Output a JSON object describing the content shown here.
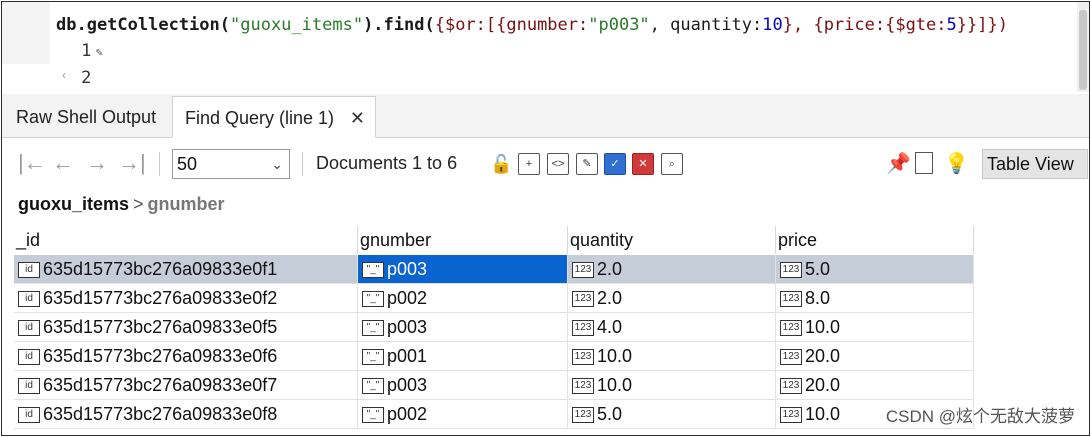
{
  "editor": {
    "line_numbers": [
      "1",
      "2"
    ],
    "code": {
      "obj": "db.getCollection(",
      "coll": "\"guoxu_items\"",
      "close_find": ").find(",
      "rest_pre": "{$or:[{gnumber:",
      "gval": "\"p003\"",
      "rest_mid": ", quantity:",
      "qval": "10",
      "rest_mid2": "}, {price:{$gte:",
      "pval": "5",
      "rest_end": "}}]})"
    }
  },
  "tabs": [
    {
      "label": "Raw Shell Output"
    },
    {
      "label": "Find Query (line 1)",
      "close": "✕"
    }
  ],
  "toolbar": {
    "nav": [
      "|←",
      "←",
      "→",
      "→|"
    ],
    "limit": "50",
    "doc_range": "Documents 1 to 6",
    "view_mode": "Table View"
  },
  "breadcrumb": {
    "collection": "guoxu_items",
    "separator": ">",
    "field": "gnumber"
  },
  "table": {
    "columns": [
      "_id",
      "gnumber",
      "quantity",
      "price"
    ],
    "rows": [
      {
        "id": "635d15773bc276a09833e0f1",
        "gnumber": "p003",
        "quantity": "2.0",
        "price": "5.0"
      },
      {
        "id": "635d15773bc276a09833e0f2",
        "gnumber": "p002",
        "quantity": "2.0",
        "price": "8.0"
      },
      {
        "id": "635d15773bc276a09833e0f5",
        "gnumber": "p003",
        "quantity": "4.0",
        "price": "10.0"
      },
      {
        "id": "635d15773bc276a09833e0f6",
        "gnumber": "p001",
        "quantity": "10.0",
        "price": "20.0"
      },
      {
        "id": "635d15773bc276a09833e0f7",
        "gnumber": "p003",
        "quantity": "10.0",
        "price": "20.0"
      },
      {
        "id": "635d15773bc276a09833e0f8",
        "gnumber": "p002",
        "quantity": "5.0",
        "price": "10.0"
      }
    ]
  },
  "icons": {
    "id_type": "id",
    "str_type": "\"_\"",
    "num_type": "123"
  },
  "watermark": "CSDN @炫个无敌大菠萝"
}
